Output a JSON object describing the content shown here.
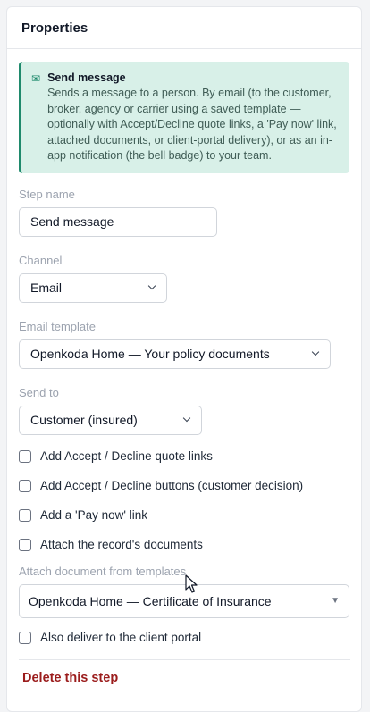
{
  "panel": {
    "title": "Properties"
  },
  "info": {
    "icon": "envelope-icon",
    "title": "Send message",
    "text": "Sends a message to a person. By email (to the customer, broker, agency or carrier using a saved template — optionally with Accept/Decline quote links, a 'Pay now' link, attached documents, or client-portal delivery), or as an in-app notification (the bell badge) to your team."
  },
  "step_name": {
    "label": "Step name",
    "value": "Send message"
  },
  "channel": {
    "label": "Channel",
    "value": "Email"
  },
  "email_template": {
    "label": "Email template",
    "value": "Openkoda Home — Your policy documents"
  },
  "send_to": {
    "label": "Send to",
    "value": "Customer (insured)"
  },
  "options": [
    {
      "label": "Add Accept / Decline quote links",
      "checked": false
    },
    {
      "label": "Add Accept / Decline buttons (customer decision)",
      "checked": false
    },
    {
      "label": "Add a 'Pay now' link",
      "checked": false
    },
    {
      "label": "Attach the record's documents",
      "checked": false
    }
  ],
  "attach_doc": {
    "label": "Attach document from templates",
    "value": "Openkoda Home — Certificate of Insurance"
  },
  "portal": {
    "label": "Also deliver to the client portal",
    "checked": false
  },
  "delete_label": "Delete this step",
  "colors": {
    "accent": "#1f8a6c",
    "info_bg": "#d8f0e8",
    "danger": "#9b1c1c"
  }
}
